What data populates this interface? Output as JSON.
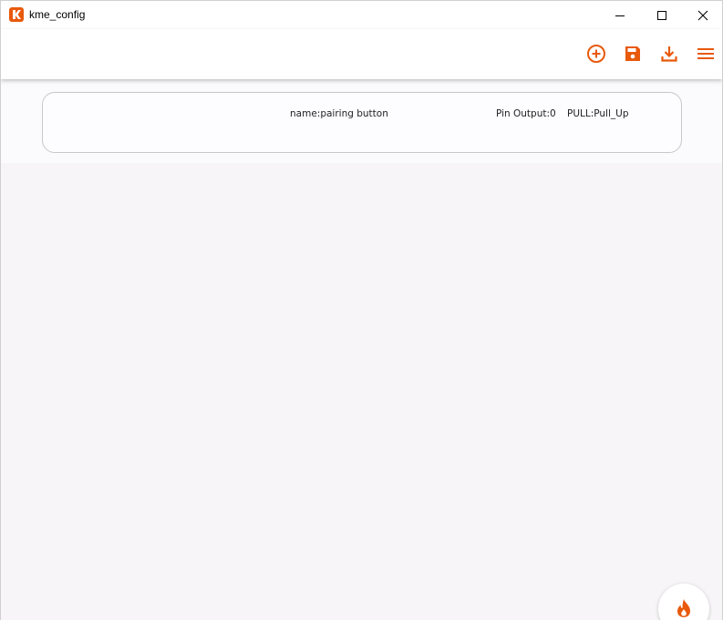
{
  "window": {
    "title": "kme_config",
    "app_icon": "kme-logo-icon",
    "controls": [
      "minimize-icon",
      "maximize-icon",
      "close-icon"
    ]
  },
  "toolbar": {
    "accent_color": "#e8590c",
    "actions": [
      {
        "name": "add",
        "icon": "add-circle-icon"
      },
      {
        "name": "save",
        "icon": "save-icon"
      },
      {
        "name": "download",
        "icon": "download-icon"
      },
      {
        "name": "menu",
        "icon": "hamburger-menu-icon"
      }
    ]
  },
  "items": [
    {
      "name_text": "name:pairing button",
      "pin_text": "Pin Output:0",
      "pull_text": "PULL:Pull_Up"
    }
  ],
  "fab": {
    "icon": "flame-icon"
  }
}
